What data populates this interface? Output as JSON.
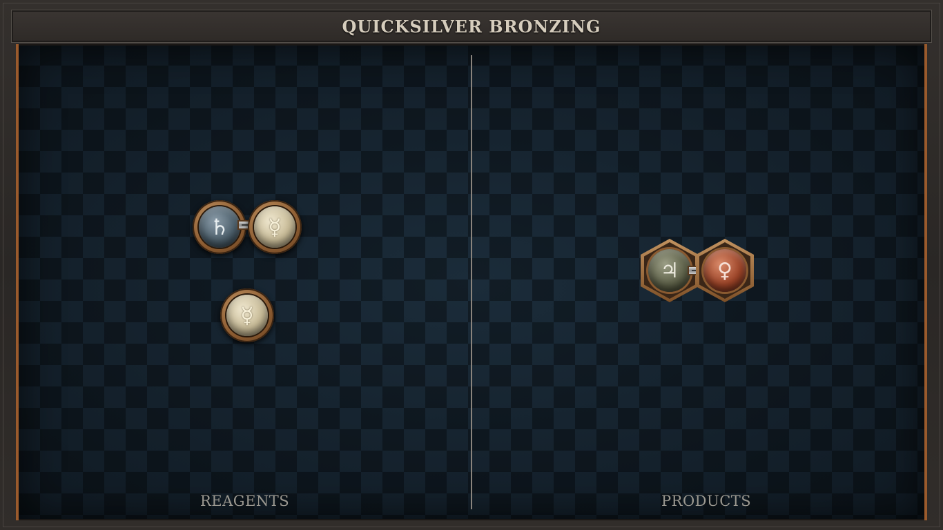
{
  "header": {
    "title": "QUICKSILVER BRONZING"
  },
  "sections": {
    "reagents_label": "REAGENTS",
    "products_label": "PRODUCTS"
  },
  "reagents": {
    "molecule_1": {
      "atoms": [
        {
          "element": "lead",
          "symbol": "♄"
        },
        {
          "element": "quicksilver",
          "symbol": "☿"
        }
      ],
      "bond": "single"
    },
    "molecule_2": {
      "atoms": [
        {
          "element": "quicksilver",
          "symbol": "☿"
        }
      ]
    }
  },
  "products": {
    "molecule_1": {
      "atoms": [
        {
          "element": "tin",
          "symbol": "♃"
        },
        {
          "element": "copper",
          "symbol": "♀"
        }
      ],
      "bond": "single"
    }
  },
  "colors": {
    "frame": "#2b2826",
    "board": "#13202b",
    "accent_border": "#9a5a2c",
    "title_text": "#d6cdbd",
    "label_text": "#9b9890"
  }
}
